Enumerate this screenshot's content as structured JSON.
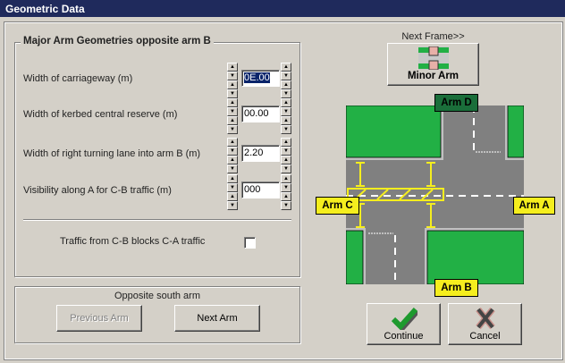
{
  "window": {
    "title": "Geometric Data"
  },
  "major_group": {
    "title": "Major Arm Geometries opposite arm B",
    "fields": [
      {
        "label": "Width of carriageway (m)",
        "value": "0E.00",
        "selected": true
      },
      {
        "label": "Width of kerbed central reserve (m)",
        "value": "00.00"
      },
      {
        "label": "Width of right turning lane into arm B (m)",
        "value": "2.20"
      },
      {
        "label": "Visibility along A for C-B traffic (m)",
        "value": "000"
      }
    ],
    "checkbox": {
      "label": "Traffic from C-B blocks C-A traffic",
      "checked": false
    }
  },
  "south_group": {
    "title": "Opposite south arm",
    "previous_label": "Previous Arm",
    "next_label": "Next Arm"
  },
  "next_frame": {
    "label": "Next Frame>>",
    "button_label": "Minor Arm"
  },
  "diagram": {
    "arms": {
      "a": "Arm A",
      "b": "Arm B",
      "c": "Arm C",
      "d": "Arm D"
    },
    "colors": {
      "grass": "#22b045",
      "road": "#808080",
      "marker": "#f5ee1e",
      "arm_d": "#1a6e3a"
    }
  },
  "actions": {
    "continue_label": "Continue",
    "cancel_label": "Cancel"
  }
}
